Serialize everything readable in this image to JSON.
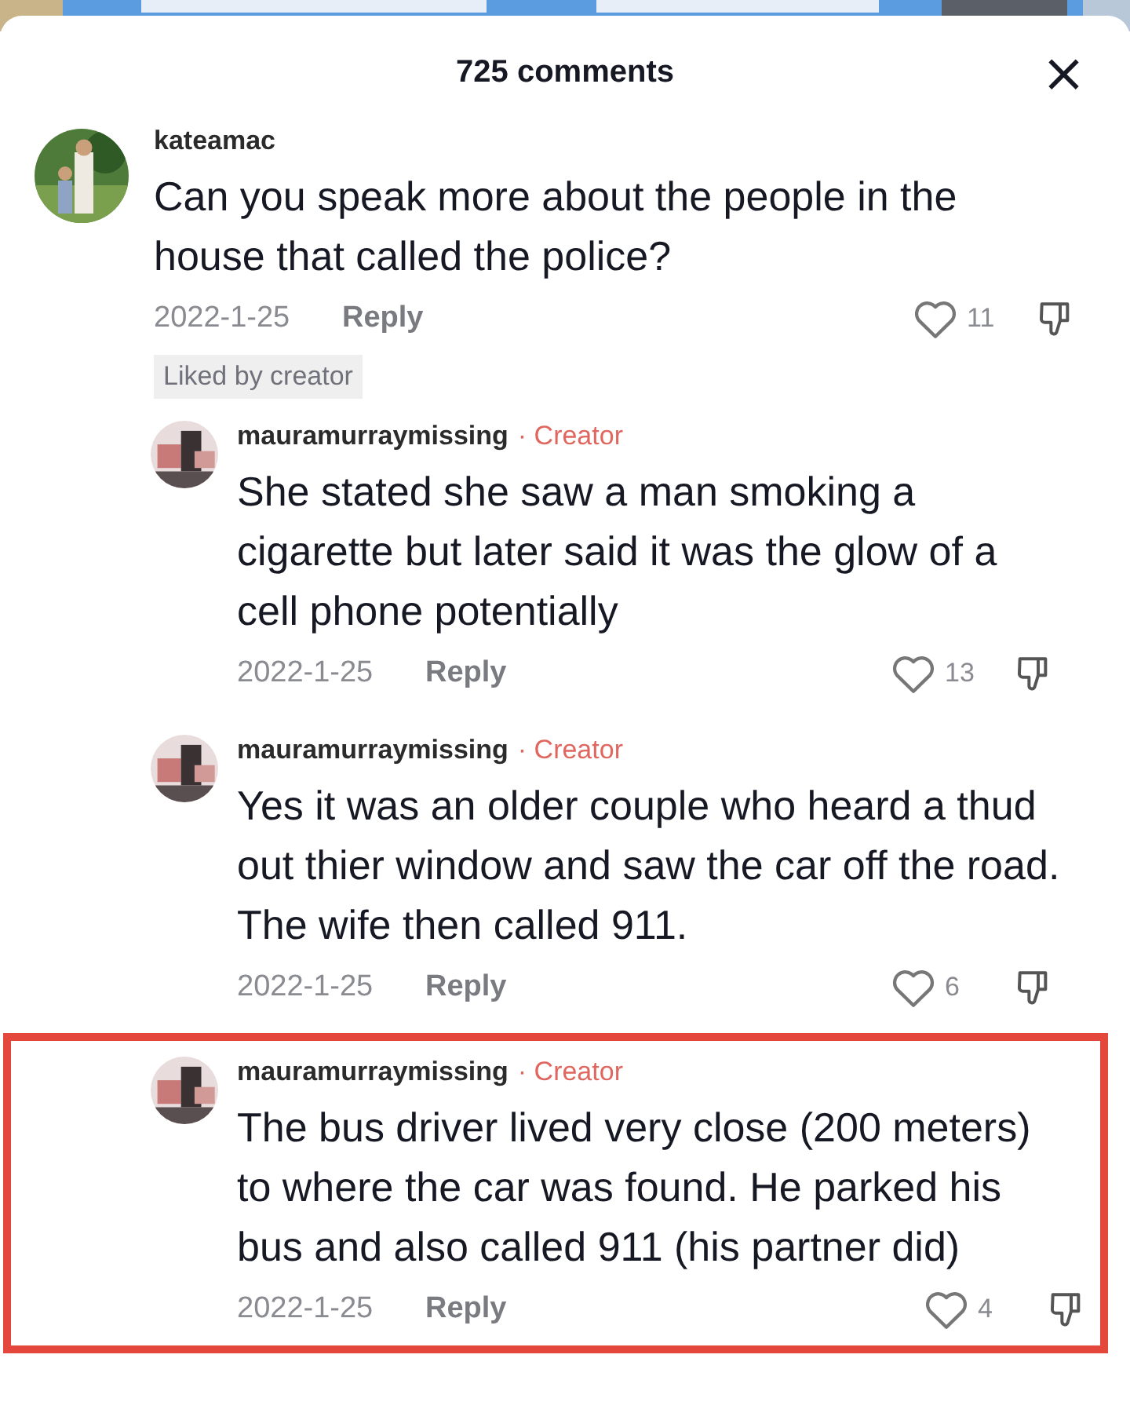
{
  "header": {
    "title": "725 comments",
    "close": "×"
  },
  "comments": [
    {
      "username": "kateamac",
      "text": "Can you speak more about the people in the house that called the police?",
      "date": "2022-1-25",
      "reply": "Reply",
      "likes": "11",
      "liked_note": "Liked by creator",
      "highlighted": false,
      "replies": [
        {
          "username": "mauramurraymissing",
          "badge": "· Creator",
          "text": "She stated she saw a man smoking a cigarette but later said it was the glow of a cell phone potentially",
          "date": "2022-1-25",
          "reply": "Reply",
          "likes": "13",
          "highlighted": false
        },
        {
          "username": "mauramurraymissing",
          "badge": "· Creator",
          "text": "Yes it was an older couple who heard a thud out thier window and saw the car off the road. The wife then called 911.",
          "date": "2022-1-25",
          "reply": "Reply",
          "likes": "6",
          "highlighted": false
        },
        {
          "username": "mauramurraymissing",
          "badge": "· Creator",
          "text": "The bus driver lived very close (200 meters) to where the car was found. He parked his bus and also called 911 (his partner did)",
          "date": "2022-1-25",
          "reply": "Reply",
          "likes": "4",
          "highlighted": true
        }
      ]
    }
  ]
}
